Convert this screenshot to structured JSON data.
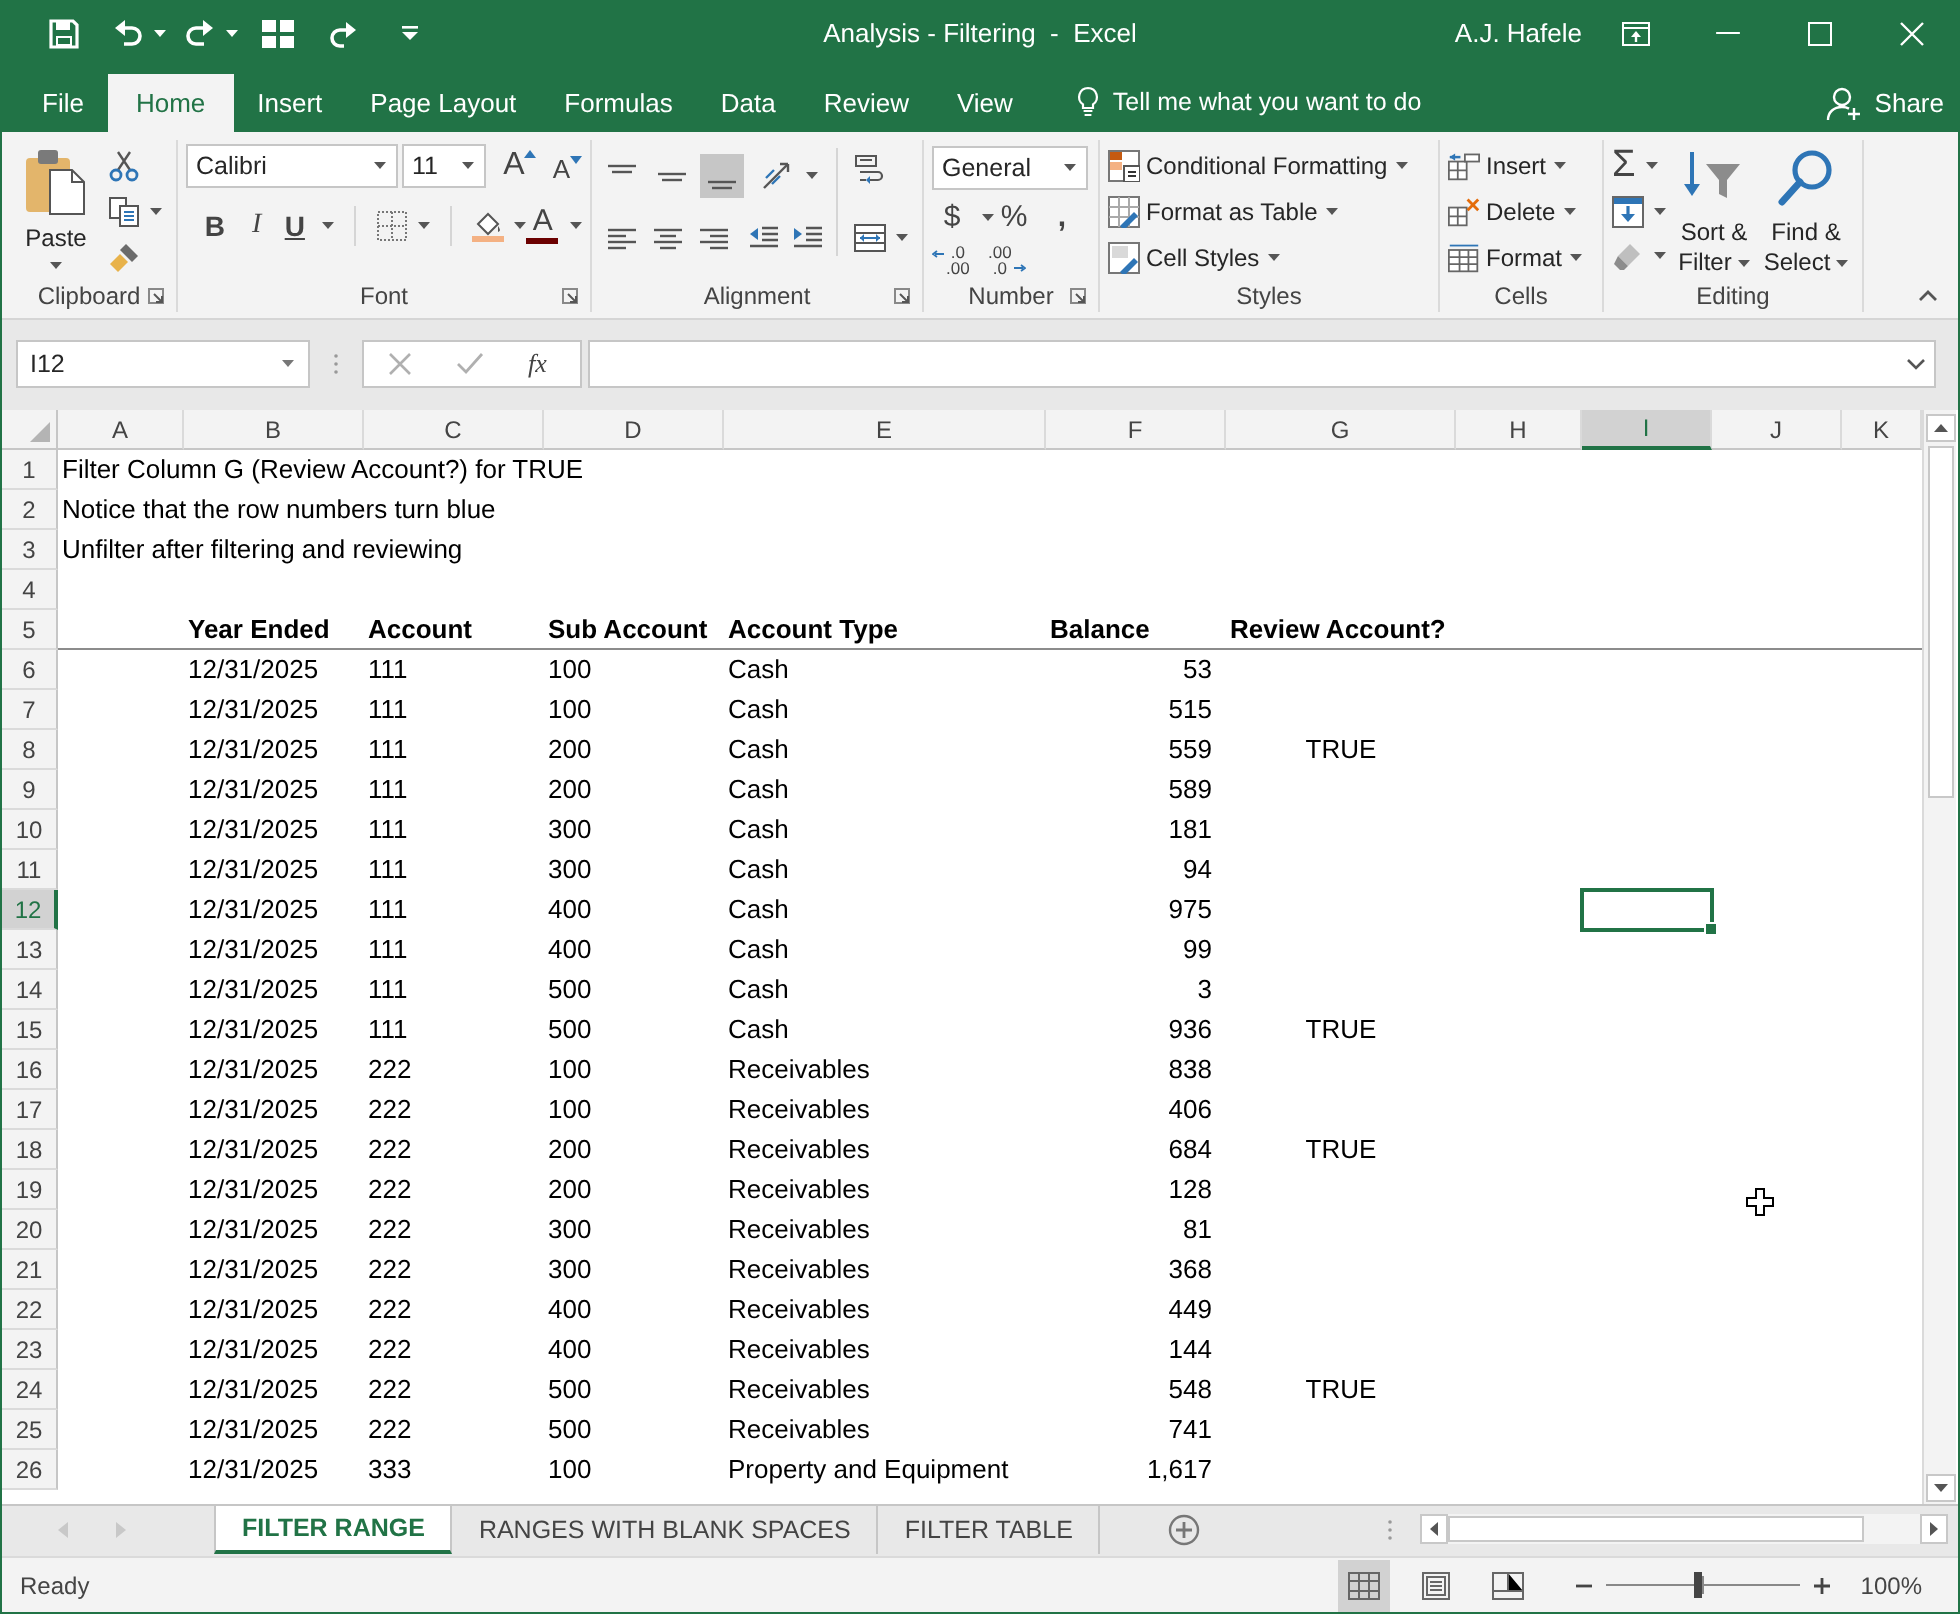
{
  "window": {
    "title": "Analysis - Filtering  -  Excel",
    "user": "A.J. Hafele"
  },
  "tabs": [
    {
      "label": "File",
      "selected": false
    },
    {
      "label": "Home",
      "selected": true
    },
    {
      "label": "Insert",
      "selected": false
    },
    {
      "label": "Page Layout",
      "selected": false
    },
    {
      "label": "Formulas",
      "selected": false
    },
    {
      "label": "Data",
      "selected": false
    },
    {
      "label": "Review",
      "selected": false
    },
    {
      "label": "View",
      "selected": false
    }
  ],
  "tell_me": {
    "placeholder": "Tell me what you want to do"
  },
  "share": "Share",
  "ribbon": {
    "clipboard": {
      "label": "Clipboard",
      "paste": "Paste"
    },
    "font": {
      "label": "Font",
      "font_name": "Calibri",
      "font_size": "11",
      "grow": "A",
      "shrink": "A",
      "bold": "B",
      "italic": "I",
      "underline": "U",
      "font_color": "A"
    },
    "alignment": {
      "label": "Alignment",
      "vertical": [
        {
          "kind": "top",
          "selected": false
        },
        {
          "kind": "middle",
          "selected": false
        },
        {
          "kind": "bottom",
          "selected": true
        }
      ],
      "horizontal": [
        {
          "kind": "left",
          "selected": false
        },
        {
          "kind": "center",
          "selected": false
        },
        {
          "kind": "right",
          "selected": false
        }
      ]
    },
    "number": {
      "label": "Number",
      "format": "General",
      "currency": "$",
      "percent": "%",
      "comma": ",",
      "increase_decimal": [
        ".0",
        ".00"
      ],
      "decrease_decimal": [
        ".00",
        ".0"
      ]
    },
    "styles": {
      "label": "Styles",
      "items": [
        "Conditional Formatting",
        "Format as Table",
        "Cell Styles"
      ]
    },
    "cells": {
      "label": "Cells",
      "items": [
        "Insert",
        "Delete",
        "Format"
      ]
    },
    "editing": {
      "label": "Editing",
      "autosum": "Σ",
      "sort_filter": [
        "Sort &",
        "Filter"
      ],
      "find_select": [
        "Find &",
        "Select"
      ]
    }
  },
  "formula_bar": {
    "name_box": "I12",
    "function_label": "fx"
  },
  "sheet": {
    "columns": [
      {
        "label": "A",
        "selected": false
      },
      {
        "label": "B",
        "selected": false
      },
      {
        "label": "C",
        "selected": false
      },
      {
        "label": "D",
        "selected": false
      },
      {
        "label": "E",
        "selected": false
      },
      {
        "label": "F",
        "selected": false
      },
      {
        "label": "G",
        "selected": false
      },
      {
        "label": "H",
        "selected": false
      },
      {
        "label": "I",
        "selected": true
      },
      {
        "label": "J",
        "selected": false
      },
      {
        "label": "K",
        "selected": false
      }
    ],
    "rows": [
      {
        "number": "1",
        "selected": false,
        "kind": "note",
        "text": "Filter Column G (Review Account?) for TRUE"
      },
      {
        "number": "2",
        "selected": false,
        "kind": "note",
        "text": "Notice that the row numbers turn blue"
      },
      {
        "number": "3",
        "selected": false,
        "kind": "note",
        "text": "Unfilter after filtering and reviewing"
      },
      {
        "number": "4",
        "selected": false,
        "kind": "blank"
      },
      {
        "number": "5",
        "selected": false,
        "kind": "header",
        "year_ended": "Year Ended",
        "account": "Account",
        "sub_account": "Sub Account",
        "account_type": "Account Type",
        "balance": "Balance",
        "review": "Review Account?"
      },
      {
        "number": "6",
        "selected": false,
        "kind": "data",
        "year_ended": "12/31/2025",
        "account": "111",
        "sub_account": "100",
        "account_type": "Cash",
        "balance": "53"
      },
      {
        "number": "7",
        "selected": false,
        "kind": "data",
        "year_ended": "12/31/2025",
        "account": "111",
        "sub_account": "100",
        "account_type": "Cash",
        "balance": "515"
      },
      {
        "number": "8",
        "selected": false,
        "kind": "data",
        "year_ended": "12/31/2025",
        "account": "111",
        "sub_account": "200",
        "account_type": "Cash",
        "balance": "559",
        "review": "TRUE"
      },
      {
        "number": "9",
        "selected": false,
        "kind": "data",
        "year_ended": "12/31/2025",
        "account": "111",
        "sub_account": "200",
        "account_type": "Cash",
        "balance": "589"
      },
      {
        "number": "10",
        "selected": false,
        "kind": "data",
        "year_ended": "12/31/2025",
        "account": "111",
        "sub_account": "300",
        "account_type": "Cash",
        "balance": "181"
      },
      {
        "number": "11",
        "selected": false,
        "kind": "data",
        "year_ended": "12/31/2025",
        "account": "111",
        "sub_account": "300",
        "account_type": "Cash",
        "balance": "94"
      },
      {
        "number": "12",
        "selected": true,
        "kind": "data",
        "year_ended": "12/31/2025",
        "account": "111",
        "sub_account": "400",
        "account_type": "Cash",
        "balance": "975"
      },
      {
        "number": "13",
        "selected": false,
        "kind": "data",
        "year_ended": "12/31/2025",
        "account": "111",
        "sub_account": "400",
        "account_type": "Cash",
        "balance": "99"
      },
      {
        "number": "14",
        "selected": false,
        "kind": "data",
        "year_ended": "12/31/2025",
        "account": "111",
        "sub_account": "500",
        "account_type": "Cash",
        "balance": "3"
      },
      {
        "number": "15",
        "selected": false,
        "kind": "data",
        "year_ended": "12/31/2025",
        "account": "111",
        "sub_account": "500",
        "account_type": "Cash",
        "balance": "936",
        "review": "TRUE"
      },
      {
        "number": "16",
        "selected": false,
        "kind": "data",
        "year_ended": "12/31/2025",
        "account": "222",
        "sub_account": "100",
        "account_type": "Receivables",
        "balance": "838"
      },
      {
        "number": "17",
        "selected": false,
        "kind": "data",
        "year_ended": "12/31/2025",
        "account": "222",
        "sub_account": "100",
        "account_type": "Receivables",
        "balance": "406"
      },
      {
        "number": "18",
        "selected": false,
        "kind": "data",
        "year_ended": "12/31/2025",
        "account": "222",
        "sub_account": "200",
        "account_type": "Receivables",
        "balance": "684",
        "review": "TRUE"
      },
      {
        "number": "19",
        "selected": false,
        "kind": "data",
        "year_ended": "12/31/2025",
        "account": "222",
        "sub_account": "200",
        "account_type": "Receivables",
        "balance": "128"
      },
      {
        "number": "20",
        "selected": false,
        "kind": "data",
        "year_ended": "12/31/2025",
        "account": "222",
        "sub_account": "300",
        "account_type": "Receivables",
        "balance": "81"
      },
      {
        "number": "21",
        "selected": false,
        "kind": "data",
        "year_ended": "12/31/2025",
        "account": "222",
        "sub_account": "300",
        "account_type": "Receivables",
        "balance": "368"
      },
      {
        "number": "22",
        "selected": false,
        "kind": "data",
        "year_ended": "12/31/2025",
        "account": "222",
        "sub_account": "400",
        "account_type": "Receivables",
        "balance": "449"
      },
      {
        "number": "23",
        "selected": false,
        "kind": "data",
        "year_ended": "12/31/2025",
        "account": "222",
        "sub_account": "400",
        "account_type": "Receivables",
        "balance": "144"
      },
      {
        "number": "24",
        "selected": false,
        "kind": "data",
        "year_ended": "12/31/2025",
        "account": "222",
        "sub_account": "500",
        "account_type": "Receivables",
        "balance": "548",
        "review": "TRUE"
      },
      {
        "number": "25",
        "selected": false,
        "kind": "data",
        "year_ended": "12/31/2025",
        "account": "222",
        "sub_account": "500",
        "account_type": "Receivables",
        "balance": "741"
      },
      {
        "number": "26",
        "selected": false,
        "kind": "data",
        "year_ended": "12/31/2025",
        "account": "333",
        "sub_account": "100",
        "account_type": "Property and Equipment",
        "balance": "1,617"
      }
    ]
  },
  "sheet_tabs": [
    {
      "label": "FILTER RANGE",
      "selected": true
    },
    {
      "label": "RANGES WITH BLANK SPACES",
      "selected": false
    },
    {
      "label": "FILTER TABLE",
      "selected": false
    }
  ],
  "status_bar": {
    "text": "Ready",
    "views": [
      {
        "kind": "normal",
        "selected": true
      },
      {
        "kind": "page_layout",
        "selected": false
      },
      {
        "kind": "page_break",
        "selected": false
      }
    ],
    "zoom": {
      "level": 0.47,
      "label": "100%"
    }
  }
}
